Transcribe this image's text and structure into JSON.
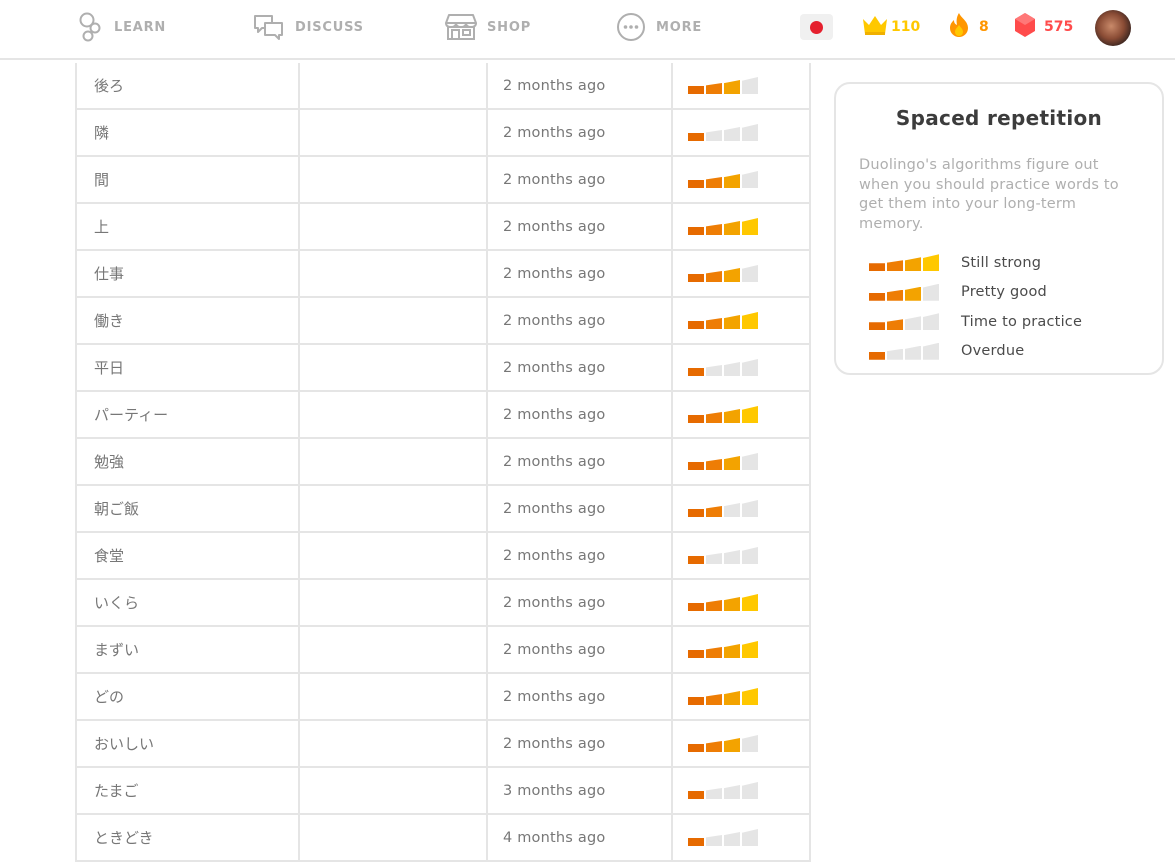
{
  "nav": {
    "items": [
      {
        "label": "LEARN",
        "icon": "learn-icon"
      },
      {
        "label": "DISCUSS",
        "icon": "discuss-icon"
      },
      {
        "label": "SHOP",
        "icon": "shop-icon"
      },
      {
        "label": "MORE",
        "icon": "more-icon"
      }
    ],
    "flag": "japanese-flag",
    "crowns": "110",
    "streak": "8",
    "gems": "575",
    "colors": {
      "crown": "#ffc800",
      "streak": "#ff9600",
      "gems": "#ff4b4b",
      "inactive": "#afafaf"
    }
  },
  "words": [
    {
      "word": "後ろ",
      "translation": "",
      "last_practiced": "2 months ago",
      "strength": 3
    },
    {
      "word": "隣",
      "translation": "",
      "last_practiced": "2 months ago",
      "strength": 1
    },
    {
      "word": "間",
      "translation": "",
      "last_practiced": "2 months ago",
      "strength": 3
    },
    {
      "word": "上",
      "translation": "",
      "last_practiced": "2 months ago",
      "strength": 4
    },
    {
      "word": "仕事",
      "translation": "",
      "last_practiced": "2 months ago",
      "strength": 3
    },
    {
      "word": "働き",
      "translation": "",
      "last_practiced": "2 months ago",
      "strength": 4
    },
    {
      "word": "平日",
      "translation": "",
      "last_practiced": "2 months ago",
      "strength": 1
    },
    {
      "word": "パーティー",
      "translation": "",
      "last_practiced": "2 months ago",
      "strength": 4
    },
    {
      "word": "勉強",
      "translation": "",
      "last_practiced": "2 months ago",
      "strength": 3
    },
    {
      "word": "朝ご飯",
      "translation": "",
      "last_practiced": "2 months ago",
      "strength": 2
    },
    {
      "word": "食堂",
      "translation": "",
      "last_practiced": "2 months ago",
      "strength": 1
    },
    {
      "word": "いくら",
      "translation": "",
      "last_practiced": "2 months ago",
      "strength": 4
    },
    {
      "word": "まずい",
      "translation": "",
      "last_practiced": "2 months ago",
      "strength": 4
    },
    {
      "word": "どの",
      "translation": "",
      "last_practiced": "2 months ago",
      "strength": 4
    },
    {
      "word": "おいしい",
      "translation": "",
      "last_practiced": "2 months ago",
      "strength": 3
    },
    {
      "word": "たまご",
      "translation": "",
      "last_practiced": "3 months ago",
      "strength": 1
    },
    {
      "word": "ときどき",
      "translation": "",
      "last_practiced": "4 months ago",
      "strength": 1
    }
  ],
  "card": {
    "title": "Spaced repetition",
    "description": "Duolingo's algorithms figure out when you should practice words to get them into your long-term memory.",
    "legend": [
      {
        "label": "Still strong",
        "strength": 4
      },
      {
        "label": "Pretty good",
        "strength": 3
      },
      {
        "label": "Time to practice",
        "strength": 2
      },
      {
        "label": "Overdue",
        "strength": 1
      }
    ]
  },
  "strength_colors": [
    "#e66a00",
    "#ee7d05",
    "#f3a300",
    "#ffc800"
  ],
  "empty_bar_color": "#e5e5e5"
}
